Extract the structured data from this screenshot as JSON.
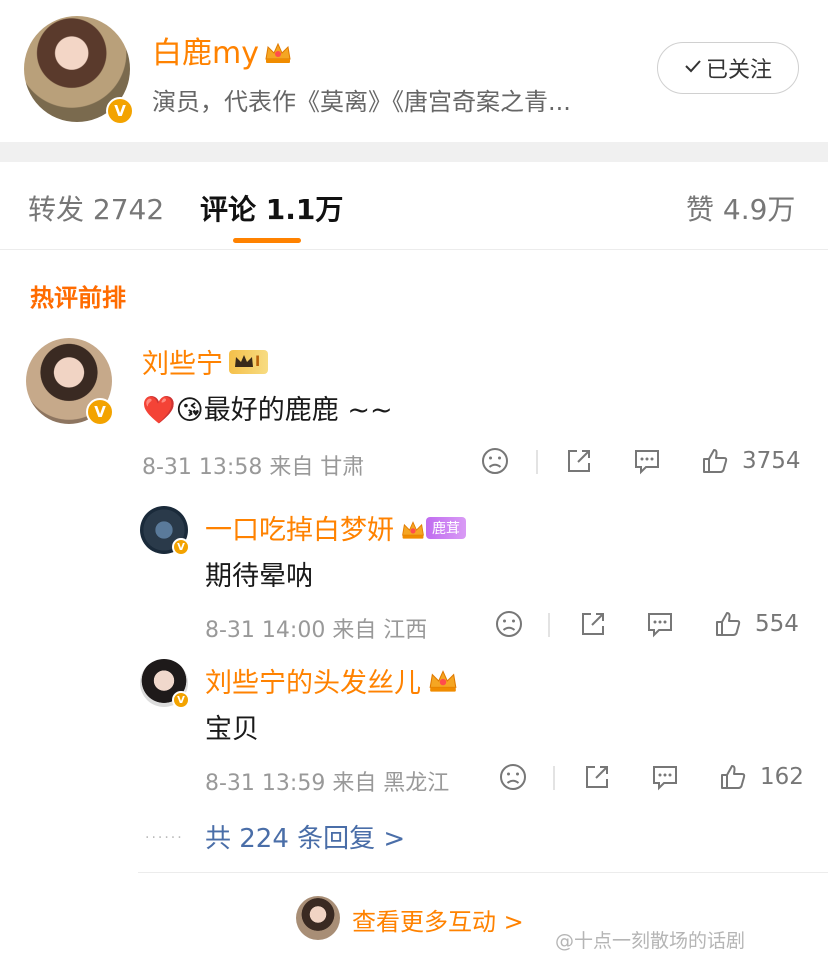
{
  "post": {
    "author_name": "白鹿my",
    "author_desc": "演员，代表作《莫离》《唐宫奇案之青...",
    "follow_label": "已关注",
    "verified_mark": "V"
  },
  "tabs": {
    "repost": "转发 2742",
    "comment": "评论 1.1万",
    "like": "赞 4.9万"
  },
  "section": {
    "title": "热评前排"
  },
  "comments": [
    {
      "name": "刘些宁",
      "level_badge": "I",
      "text": "❤️😘最好的鹿鹿 ~~",
      "meta": "8-31 13:58  来自 甘肃",
      "likes": "3754"
    },
    {
      "name": "一口吃掉白梦妍",
      "fan_badge": "鹿茸",
      "text": "期待晕呐",
      "meta": "8-31 14:00  来自 江西",
      "likes": "554"
    },
    {
      "name": "刘些宁的头发丝儿",
      "text": "宝贝",
      "meta": "8-31 13:59  来自 黑龙江",
      "likes": "162"
    }
  ],
  "more_replies": "共 224 条回复 >",
  "dots": "......",
  "bottom_link": "查看更多互动 >",
  "watermark": "@十点一刻散场的话剧",
  "colors": {
    "accent": "#ff8200",
    "link": "#4a6ea8",
    "verified": "#f3a300"
  }
}
